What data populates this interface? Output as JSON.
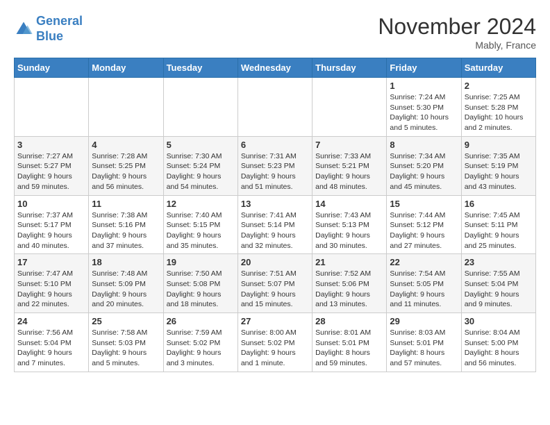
{
  "logo": {
    "line1": "General",
    "line2": "Blue"
  },
  "title": "November 2024",
  "location": "Mably, France",
  "weekdays": [
    "Sunday",
    "Monday",
    "Tuesday",
    "Wednesday",
    "Thursday",
    "Friday",
    "Saturday"
  ],
  "weeks": [
    [
      {
        "day": "",
        "info": ""
      },
      {
        "day": "",
        "info": ""
      },
      {
        "day": "",
        "info": ""
      },
      {
        "day": "",
        "info": ""
      },
      {
        "day": "",
        "info": ""
      },
      {
        "day": "1",
        "info": "Sunrise: 7:24 AM\nSunset: 5:30 PM\nDaylight: 10 hours and 5 minutes."
      },
      {
        "day": "2",
        "info": "Sunrise: 7:25 AM\nSunset: 5:28 PM\nDaylight: 10 hours and 2 minutes."
      }
    ],
    [
      {
        "day": "3",
        "info": "Sunrise: 7:27 AM\nSunset: 5:27 PM\nDaylight: 9 hours and 59 minutes."
      },
      {
        "day": "4",
        "info": "Sunrise: 7:28 AM\nSunset: 5:25 PM\nDaylight: 9 hours and 56 minutes."
      },
      {
        "day": "5",
        "info": "Sunrise: 7:30 AM\nSunset: 5:24 PM\nDaylight: 9 hours and 54 minutes."
      },
      {
        "day": "6",
        "info": "Sunrise: 7:31 AM\nSunset: 5:23 PM\nDaylight: 9 hours and 51 minutes."
      },
      {
        "day": "7",
        "info": "Sunrise: 7:33 AM\nSunset: 5:21 PM\nDaylight: 9 hours and 48 minutes."
      },
      {
        "day": "8",
        "info": "Sunrise: 7:34 AM\nSunset: 5:20 PM\nDaylight: 9 hours and 45 minutes."
      },
      {
        "day": "9",
        "info": "Sunrise: 7:35 AM\nSunset: 5:19 PM\nDaylight: 9 hours and 43 minutes."
      }
    ],
    [
      {
        "day": "10",
        "info": "Sunrise: 7:37 AM\nSunset: 5:17 PM\nDaylight: 9 hours and 40 minutes."
      },
      {
        "day": "11",
        "info": "Sunrise: 7:38 AM\nSunset: 5:16 PM\nDaylight: 9 hours and 37 minutes."
      },
      {
        "day": "12",
        "info": "Sunrise: 7:40 AM\nSunset: 5:15 PM\nDaylight: 9 hours and 35 minutes."
      },
      {
        "day": "13",
        "info": "Sunrise: 7:41 AM\nSunset: 5:14 PM\nDaylight: 9 hours and 32 minutes."
      },
      {
        "day": "14",
        "info": "Sunrise: 7:43 AM\nSunset: 5:13 PM\nDaylight: 9 hours and 30 minutes."
      },
      {
        "day": "15",
        "info": "Sunrise: 7:44 AM\nSunset: 5:12 PM\nDaylight: 9 hours and 27 minutes."
      },
      {
        "day": "16",
        "info": "Sunrise: 7:45 AM\nSunset: 5:11 PM\nDaylight: 9 hours and 25 minutes."
      }
    ],
    [
      {
        "day": "17",
        "info": "Sunrise: 7:47 AM\nSunset: 5:10 PM\nDaylight: 9 hours and 22 minutes."
      },
      {
        "day": "18",
        "info": "Sunrise: 7:48 AM\nSunset: 5:09 PM\nDaylight: 9 hours and 20 minutes."
      },
      {
        "day": "19",
        "info": "Sunrise: 7:50 AM\nSunset: 5:08 PM\nDaylight: 9 hours and 18 minutes."
      },
      {
        "day": "20",
        "info": "Sunrise: 7:51 AM\nSunset: 5:07 PM\nDaylight: 9 hours and 15 minutes."
      },
      {
        "day": "21",
        "info": "Sunrise: 7:52 AM\nSunset: 5:06 PM\nDaylight: 9 hours and 13 minutes."
      },
      {
        "day": "22",
        "info": "Sunrise: 7:54 AM\nSunset: 5:05 PM\nDaylight: 9 hours and 11 minutes."
      },
      {
        "day": "23",
        "info": "Sunrise: 7:55 AM\nSunset: 5:04 PM\nDaylight: 9 hours and 9 minutes."
      }
    ],
    [
      {
        "day": "24",
        "info": "Sunrise: 7:56 AM\nSunset: 5:04 PM\nDaylight: 9 hours and 7 minutes."
      },
      {
        "day": "25",
        "info": "Sunrise: 7:58 AM\nSunset: 5:03 PM\nDaylight: 9 hours and 5 minutes."
      },
      {
        "day": "26",
        "info": "Sunrise: 7:59 AM\nSunset: 5:02 PM\nDaylight: 9 hours and 3 minutes."
      },
      {
        "day": "27",
        "info": "Sunrise: 8:00 AM\nSunset: 5:02 PM\nDaylight: 9 hours and 1 minute."
      },
      {
        "day": "28",
        "info": "Sunrise: 8:01 AM\nSunset: 5:01 PM\nDaylight: 8 hours and 59 minutes."
      },
      {
        "day": "29",
        "info": "Sunrise: 8:03 AM\nSunset: 5:01 PM\nDaylight: 8 hours and 57 minutes."
      },
      {
        "day": "30",
        "info": "Sunrise: 8:04 AM\nSunset: 5:00 PM\nDaylight: 8 hours and 56 minutes."
      }
    ]
  ]
}
